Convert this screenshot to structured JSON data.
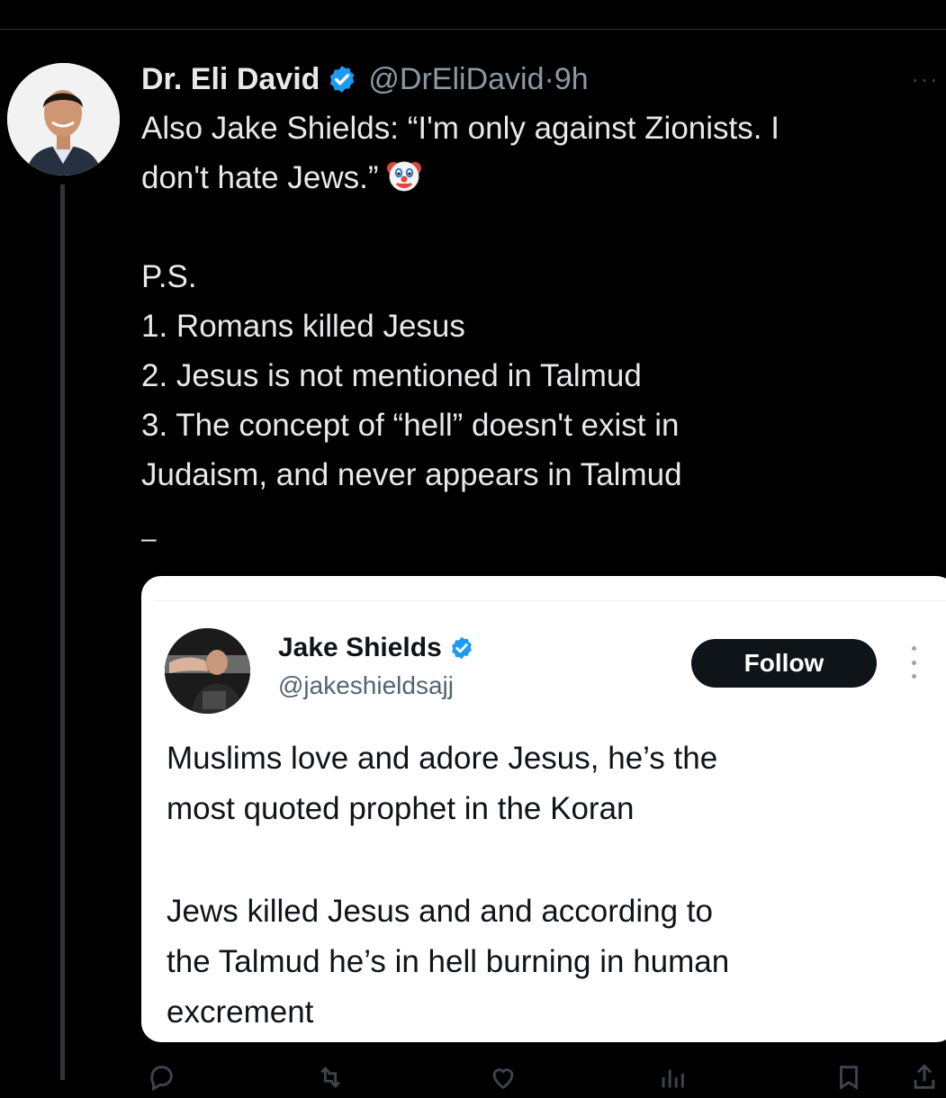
{
  "tweet": {
    "author_name": "Dr. Eli David",
    "handle": "@DrEliDavid",
    "separator": "·",
    "time": "9h",
    "more": "···",
    "lines": [
      "Also Jake Shields: “I'm only against Zionists. I",
      "don't hate Jews.”",
      "",
      "P.S.",
      "1. Romans killed Jesus",
      "2. Jesus is not mentioned in Talmud",
      "3. The concept of “hell” doesn't exist in",
      "Judaism, and never appears in Talmud"
    ],
    "trailing_dash": "–"
  },
  "quote": {
    "author_name": "Jake Shields",
    "handle": "@jakeshieldsajj",
    "follow_label": "Follow",
    "lines": [
      "Muslims love and adore Jesus, he’s the",
      "most quoted prophet in the Koran",
      "",
      "Jews killed Jesus and and according to",
      "the Talmud he’s in hell burning in human",
      "excrement"
    ]
  },
  "icons": {
    "verified": "verified-badge-icon",
    "emoji": "clown-face-emoji-icon",
    "more": "more-options-icon",
    "reply": "reply-icon",
    "repost": "repost-icon",
    "like": "like-icon",
    "views": "views-icon",
    "bookmark": "bookmark-icon",
    "share": "share-icon"
  },
  "colors": {
    "background": "#000000",
    "verified_blue": "#1d9bf0",
    "text_primary": "#e7e9ea",
    "text_secondary": "#8b98a5"
  }
}
